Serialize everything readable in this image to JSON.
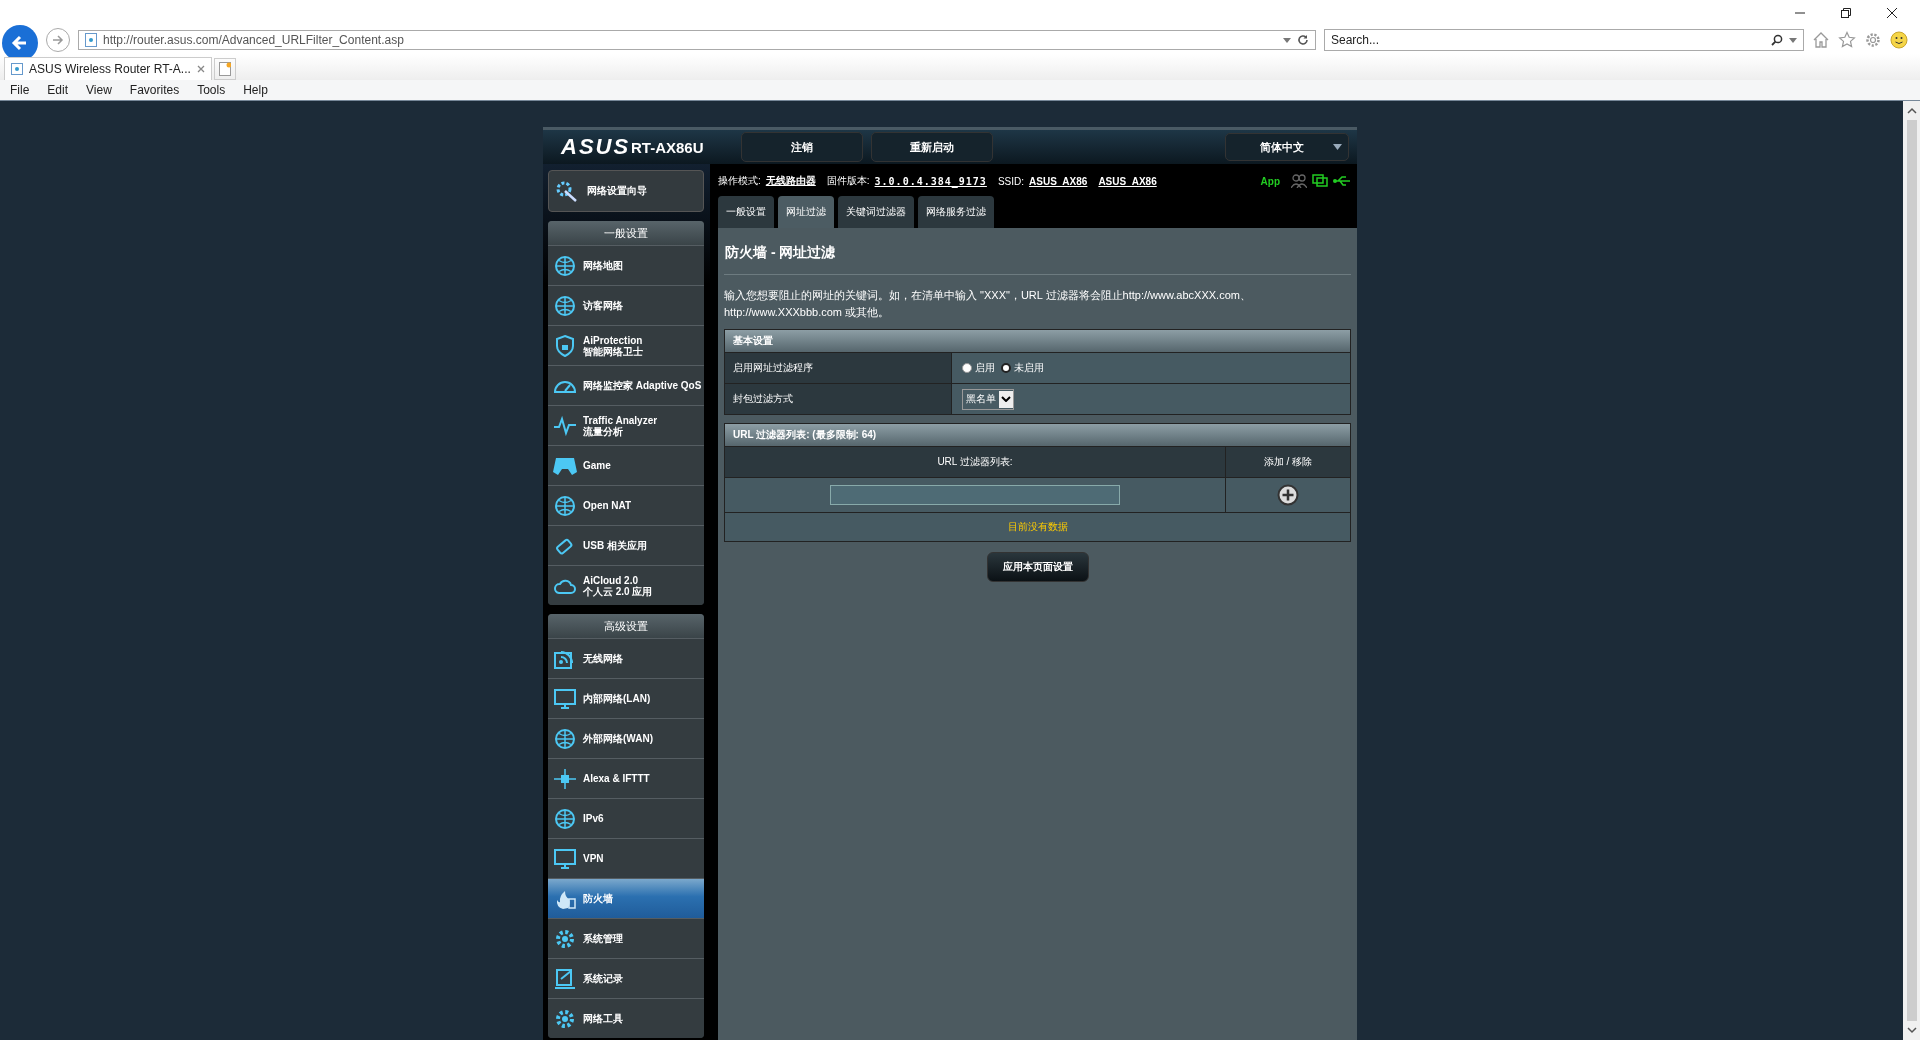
{
  "browser": {
    "address": "http://router.asus.com/Advanced_URLFilter_Content.asp",
    "search": {
      "placeholder": "Search..."
    },
    "tab_title": "ASUS Wireless Router RT-A...",
    "menu": [
      "File",
      "Edit",
      "View",
      "Favorites",
      "Tools",
      "Help"
    ]
  },
  "header": {
    "logo": "ASUS",
    "model": "RT-AX86U",
    "buttons": [
      "注销",
      "重新启动"
    ],
    "language": "简体中文"
  },
  "status": {
    "mode_label": "操作模式:",
    "mode": "无线路由器",
    "firmware_label": "固件版本:",
    "firmware": "3.0.0.4.384_9173",
    "ssid_label": "SSID:",
    "ssids": [
      "ASUS_AX86",
      "ASUS_AX86"
    ],
    "app": "App"
  },
  "sidebar": {
    "wizard": "网络设置向导",
    "sections": [
      {
        "title": "一般设置",
        "items": [
          {
            "label": "网络地图",
            "selected": false
          },
          {
            "label": "访客网络",
            "selected": false
          },
          {
            "label": "AiProtection\n智能网络卫士",
            "selected": false
          },
          {
            "label": "网络监控家 Adaptive QoS",
            "selected": false
          },
          {
            "label": "Traffic Analyzer\n流量分析",
            "selected": false
          },
          {
            "label": "Game",
            "selected": false
          },
          {
            "label": "Open NAT",
            "selected": false
          },
          {
            "label": "USB 相关应用",
            "selected": false
          },
          {
            "label": "AiCloud 2.0\n个人云 2.0 应用",
            "selected": false
          }
        ]
      },
      {
        "title": "高级设置",
        "items": [
          {
            "label": "无线网络",
            "selected": false
          },
          {
            "label": "内部网络(LAN)",
            "selected": false
          },
          {
            "label": "外部网络(WAN)",
            "selected": false
          },
          {
            "label": "Alexa & IFTTT",
            "selected": false
          },
          {
            "label": "IPv6",
            "selected": false
          },
          {
            "label": "VPN",
            "selected": false
          },
          {
            "label": "防火墙",
            "selected": true
          },
          {
            "label": "系统管理",
            "selected": false
          },
          {
            "label": "系统记录",
            "selected": false
          },
          {
            "label": "网络工具",
            "selected": false
          }
        ]
      }
    ]
  },
  "tabs": [
    {
      "label": "一般设置",
      "selected": false
    },
    {
      "label": "网址过滤",
      "selected": true
    },
    {
      "label": "关键词过滤器",
      "selected": false
    },
    {
      "label": "网络服务过滤",
      "selected": false
    }
  ],
  "page": {
    "title": "防火墙 - 网址过滤",
    "description": "输入您想要阻止的网址的关键词。如，在清单中输入 \"XXX\"，URL 过滤器将会阻止http://www.abcXXX.com、http://www.XXXbbb.com 或其他。",
    "basic": {
      "title": "基本设置",
      "enable_label": "启用网址过滤程序",
      "options": [
        {
          "label": "启用",
          "selected": false
        },
        {
          "label": "未启用",
          "selected": true
        }
      ],
      "mode_label": "封包过滤方式",
      "mode_value": "黑名单"
    },
    "list": {
      "title": "URL 过滤器列表: (最多限制: 64)",
      "columns": [
        "URL 过滤器列表:",
        "添加 / 移除"
      ],
      "empty": "目前没有数据"
    },
    "apply": "应用本页面设置"
  }
}
